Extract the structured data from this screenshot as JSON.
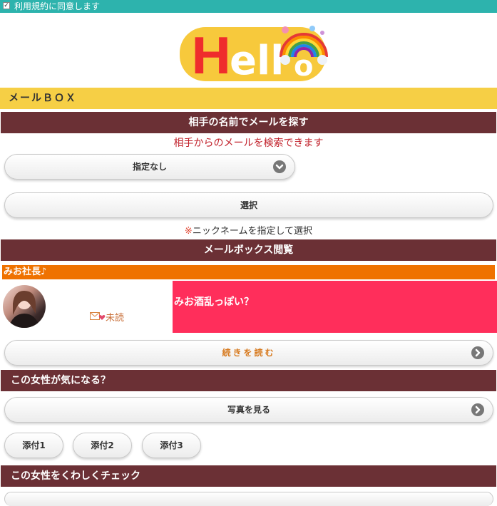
{
  "topbar": {
    "checkbox_label": "利用規約に同意します",
    "checked": true
  },
  "logo": {
    "text": "Hello"
  },
  "mailbox": {
    "title": "メールＢＯＸ"
  },
  "search": {
    "title": "相手の名前でメールを探す",
    "description": "相手からのメールを検索できます",
    "select_value": "指定なし",
    "choose_button": "選択",
    "note_mark": "※",
    "note_text": "ニックネームを指定して選択"
  },
  "mailbox_view": {
    "title": "メールボックス閲覧",
    "sender_name": "みお社長♪",
    "status": "未読",
    "message_subject": "みお酒乱っぽい？",
    "read_more": "続きを読む"
  },
  "interest": {
    "title": "この女性が気になる？",
    "photos_button": "写真を見る",
    "attachments": [
      "添付1",
      "添付2",
      "添付3"
    ]
  },
  "detail": {
    "title": "この女性をくわしくチェック"
  },
  "colors": {
    "teal": "#2db3ad",
    "yellow": "#f6cf45",
    "maroon": "#6b3035",
    "orange": "#ef7200",
    "pink": "#ff2e5b",
    "red_text": "#c1202a"
  }
}
